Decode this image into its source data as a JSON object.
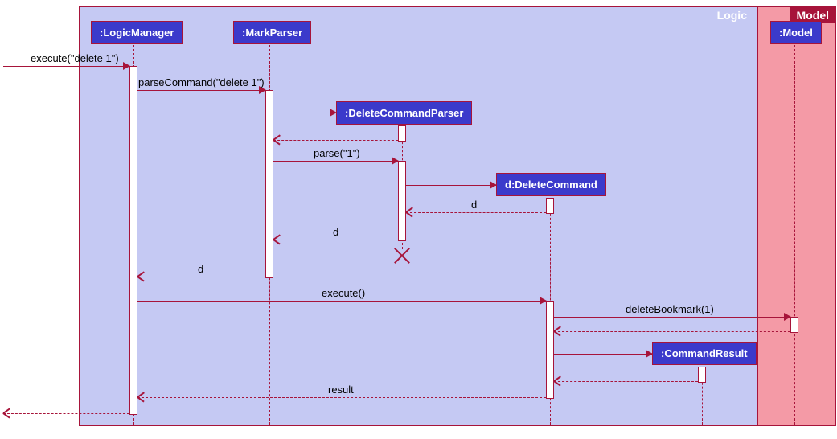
{
  "frames": {
    "logic": "Logic",
    "model": "Model"
  },
  "participants": {
    "logicManager": ":LogicManager",
    "markParser": ":MarkParser",
    "deleteCommandParser": ":DeleteCommandParser",
    "deleteCommand": "d:DeleteCommand",
    "commandResult": ":CommandResult",
    "model": ":Model"
  },
  "messages": {
    "execute_in": "execute(\"delete 1\")",
    "parseCommand": "parseCommand(\"delete 1\")",
    "parse": "parse(\"1\")",
    "d1": "d",
    "d2": "d",
    "d3": "d",
    "executeCall": "execute()",
    "deleteBookmark": "deleteBookmark(1)",
    "result": "result"
  },
  "chart_data": {
    "type": "sequence_diagram",
    "frames": [
      {
        "name": "Logic",
        "contains": [
          ":LogicManager",
          ":MarkParser",
          ":DeleteCommandParser",
          "d:DeleteCommand",
          ":CommandResult"
        ]
      },
      {
        "name": "Model",
        "contains": [
          ":Model"
        ]
      }
    ],
    "lifelines": [
      {
        "id": "logicManager",
        "label": ":LogicManager",
        "created_at_start": true
      },
      {
        "id": "markParser",
        "label": ":MarkParser",
        "created_at_start": true
      },
      {
        "id": "deleteCommandParser",
        "label": ":DeleteCommandParser",
        "created_at_start": false,
        "destroyed": true
      },
      {
        "id": "deleteCommand",
        "label": "d:DeleteCommand",
        "created_at_start": false
      },
      {
        "id": "commandResult",
        "label": ":CommandResult",
        "created_at_start": false
      },
      {
        "id": "model",
        "label": ":Model",
        "created_at_start": true
      }
    ],
    "messages": [
      {
        "from": "external",
        "to": "logicManager",
        "label": "execute(\"delete 1\")",
        "type": "sync"
      },
      {
        "from": "logicManager",
        "to": "markParser",
        "label": "parseCommand(\"delete 1\")",
        "type": "sync"
      },
      {
        "from": "markParser",
        "to": "deleteCommandParser",
        "label": "",
        "type": "create"
      },
      {
        "from": "deleteCommandParser",
        "to": "markParser",
        "label": "",
        "type": "return"
      },
      {
        "from": "markParser",
        "to": "deleteCommandParser",
        "label": "parse(\"1\")",
        "type": "sync"
      },
      {
        "from": "deleteCommandParser",
        "to": "deleteCommand",
        "label": "",
        "type": "create"
      },
      {
        "from": "deleteCommand",
        "to": "deleteCommandParser",
        "label": "d",
        "type": "return"
      },
      {
        "from": "deleteCommandParser",
        "to": "markParser",
        "label": "d",
        "type": "return"
      },
      {
        "from": "deleteCommandParser",
        "to": null,
        "label": "",
        "type": "destroy"
      },
      {
        "from": "markParser",
        "to": "logicManager",
        "label": "d",
        "type": "return"
      },
      {
        "from": "logicManager",
        "to": "deleteCommand",
        "label": "execute()",
        "type": "sync"
      },
      {
        "from": "deleteCommand",
        "to": "model",
        "label": "deleteBookmark(1)",
        "type": "sync"
      },
      {
        "from": "model",
        "to": "deleteCommand",
        "label": "",
        "type": "return"
      },
      {
        "from": "deleteCommand",
        "to": "commandResult",
        "label": "",
        "type": "create"
      },
      {
        "from": "commandResult",
        "to": "deleteCommand",
        "label": "",
        "type": "return"
      },
      {
        "from": "deleteCommand",
        "to": "logicManager",
        "label": "result",
        "type": "return"
      },
      {
        "from": "logicManager",
        "to": "external",
        "label": "",
        "type": "return"
      }
    ]
  }
}
